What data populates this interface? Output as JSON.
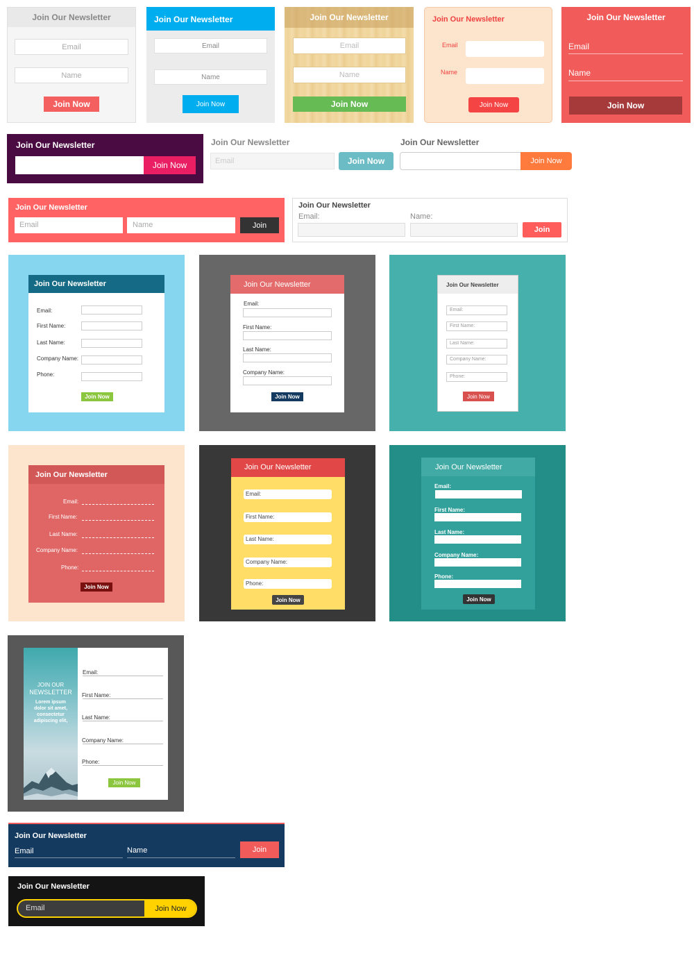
{
  "newsletter": {
    "title": "Join Our Newsletter",
    "title_upper_line1": "JOIN OUR",
    "title_upper_line2": "NEWSLETTER",
    "lorem": "Lorem ipsum dolor sit amet, consectetur adipiscing elit,"
  },
  "fields": {
    "email": "Email",
    "name": "Name",
    "email_colon": "Email:",
    "name_colon": "Name:",
    "first_name": "First Name:",
    "last_name": "Last Name:",
    "company_name": "Company Name:",
    "phone": "Phone:"
  },
  "buttons": {
    "join_now": "Join Now",
    "join": "Join"
  },
  "colors": {
    "red": "#f15b5a",
    "blue": "#00aef0",
    "green": "#66bb55",
    "purple": "#4a0a42",
    "pink": "#e91e63",
    "teal": "#3fa9a8",
    "navy": "#143a5f",
    "yellow": "#ffd200"
  }
}
